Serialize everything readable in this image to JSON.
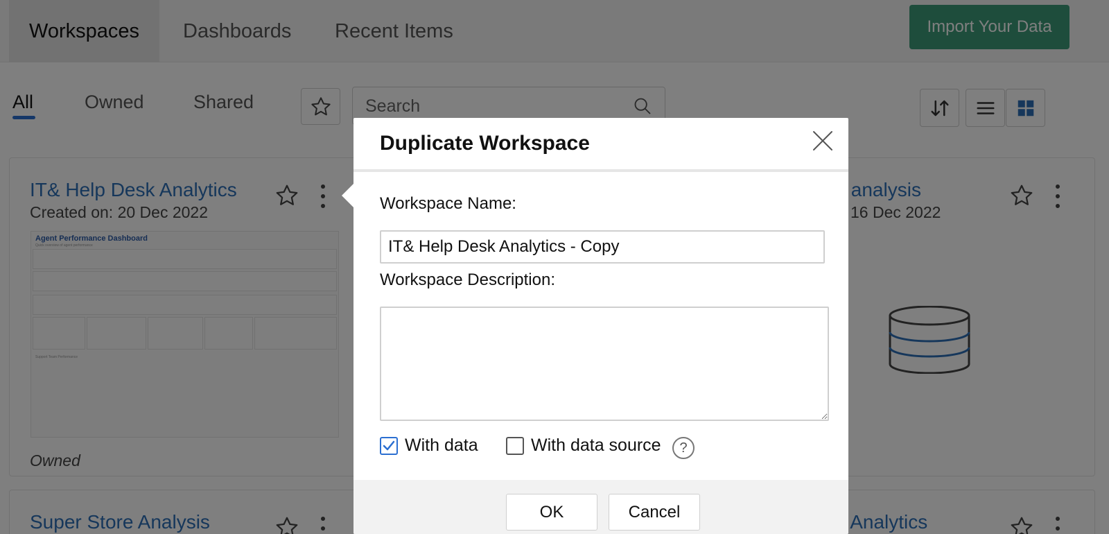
{
  "top_nav": {
    "tabs": [
      {
        "label": "Workspaces",
        "active": true
      },
      {
        "label": "Dashboards",
        "active": false
      },
      {
        "label": "Recent Items",
        "active": false
      }
    ],
    "import_button": "Import Your Data",
    "import_color": "#3d9a78"
  },
  "filters": {
    "tabs": [
      "All",
      "Owned",
      "Shared"
    ],
    "active": "All",
    "search_placeholder": "Search"
  },
  "toolbar_icons": [
    "sort-icon",
    "list-view-icon",
    "grid-view-icon"
  ],
  "cards": [
    {
      "title": "IT& Help Desk Analytics",
      "date": "Created on: 20 Dec 2022",
      "owner_label": "Owned",
      "thumbnail": {
        "title": "Agent Performance Dashboard",
        "subtitle": "Quick overview of agent performance",
        "section": "Support Team Performance"
      }
    },
    {
      "title_partial": "s analysis",
      "date_partial": "16 Dec 2022",
      "icon": "database-icon"
    },
    {
      "title": "Super Store Analysis"
    },
    {
      "title_partial": "k Analytics"
    }
  ],
  "dialog": {
    "title": "Duplicate Workspace",
    "name_label": "Workspace Name:",
    "name_value": "IT& Help Desk Analytics - Copy",
    "description_label": "Workspace Description:",
    "description_value": "",
    "with_data_label": "With data",
    "with_data_checked": true,
    "with_source_label": "With data source",
    "with_source_checked": false,
    "help_glyph": "?",
    "ok_label": "OK",
    "cancel_label": "Cancel"
  },
  "colors": {
    "link_blue": "#2d6fb7",
    "accent_blue": "#2b6fd1",
    "overlay": "rgba(0,0,0,0.5)"
  }
}
